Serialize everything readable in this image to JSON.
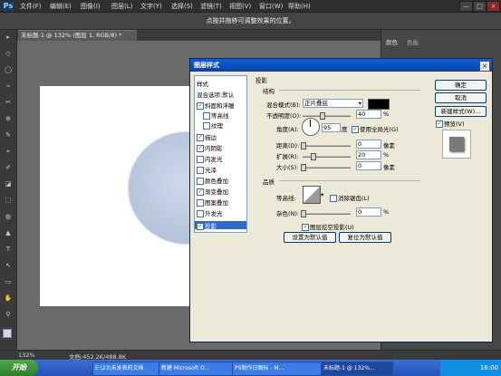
{
  "menubar": {
    "logo": "Ps",
    "items": [
      "文件(F)",
      "编辑(E)",
      "图像(I)",
      "图层(L)",
      "文字(Y)",
      "选择(S)",
      "滤镜(T)",
      "视图(V)",
      "窗口(W)",
      "帮助(H)"
    ],
    "window_buttons": [
      "—",
      "□",
      "×"
    ]
  },
  "options_bar": {
    "hint": "点按并拖移可调整效果的位置。"
  },
  "document": {
    "tab": "未标题-1 @ 132% (图层 1, RGB/8) *"
  },
  "toolbar": {
    "tools": [
      "▸",
      "◇",
      "◯",
      "⌁",
      "✂",
      "⊕",
      "✎",
      "⌖",
      "✐",
      "◪",
      "⬚",
      "◍",
      "▲",
      "T",
      "↖",
      "▭",
      "✋",
      "⚲"
    ]
  },
  "right_panel": {
    "tabs": [
      "颜色",
      "色板"
    ]
  },
  "status": {
    "zoom": "132%",
    "doc": "文档:452.2K/488.8K"
  },
  "taskbar": {
    "start": "开始",
    "items": [
      {
        "label": "E:\\23\\未发表的文档"
      },
      {
        "label": "新建 Microsoft O..."
      },
      {
        "label": "PS制作日图标 - M..."
      },
      {
        "label": "未标题-1 @ 132%..."
      }
    ],
    "time": "16:00"
  },
  "dialog": {
    "title": "图层样式",
    "close": "×",
    "styles_header": "样式",
    "blend_default": "混合选项:默认",
    "styles": [
      {
        "label": "斜面和浮雕",
        "checked": true
      },
      {
        "label": "等高线",
        "checked": false
      },
      {
        "label": "纹理",
        "checked": false
      },
      {
        "label": "描边",
        "checked": true
      },
      {
        "label": "内阴影",
        "checked": true
      },
      {
        "label": "内发光",
        "checked": false
      },
      {
        "label": "光泽",
        "checked": false
      },
      {
        "label": "颜色叠加",
        "checked": false
      },
      {
        "label": "渐变叠加",
        "checked": true
      },
      {
        "label": "图案叠加",
        "checked": false
      },
      {
        "label": "外发光",
        "checked": false
      },
      {
        "label": "投影",
        "checked": true
      }
    ],
    "section_title": "投影",
    "structure_title": "结构",
    "blend_mode_label": "混合模式(B):",
    "blend_mode_value": "正片叠底",
    "shadow_color": "#000000",
    "opacity_label": "不透明度(O):",
    "opacity_value": "40",
    "opacity_pct": 0.4,
    "angle_label": "角度(A):",
    "angle_value": "95",
    "angle_unit": "度",
    "global_light_label": "使用全局光(G)",
    "distance_label": "距离(D):",
    "distance_value": "0",
    "distance_unit": "像素",
    "spread_label": "扩展(R):",
    "spread_value": "20",
    "spread_pct": 0.2,
    "size_label": "大小(S):",
    "size_value": "0",
    "size_unit": "像素",
    "quality_title": "品质",
    "contour_label": "等高线:",
    "antialias_label": "消除锯齿(L)",
    "noise_label": "杂色(N):",
    "noise_value": "0",
    "knockout_label": "图层挖空投影(U)",
    "set_default": "设置为默认值",
    "reset_default": "复位为默认值",
    "ok": "确定",
    "cancel": "取消",
    "new_style": "新建样式(W)...",
    "preview_label": "预览(V)",
    "pct": "%"
  }
}
